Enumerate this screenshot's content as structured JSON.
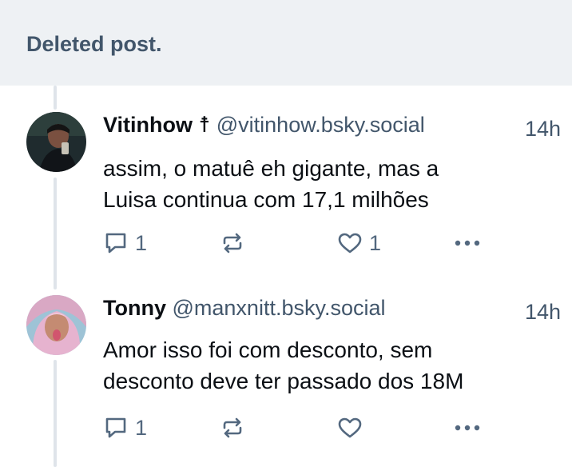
{
  "deleted_banner": {
    "text": "Deleted post."
  },
  "posts": [
    {
      "display_name": "Vitinhow",
      "name_suffix": "☨",
      "handle": "@vitinhow.bsky.social",
      "time": "14h",
      "text_line1": "assim, o matuê eh gigante, mas a",
      "text_line2": "Luisa continua com 17,1 milhões",
      "reply_count": "1",
      "repost_count": "",
      "like_count": "1",
      "liked": false
    },
    {
      "display_name": "Tonny",
      "handle": "@manxnitt.bsky.social",
      "time": "14h",
      "text_line1": "Amor isso foi com desconto, sem",
      "text_line2": "desconto deve ter passado dos 18M",
      "reply_count": "1",
      "repost_count": "",
      "like_count": "",
      "liked": false
    }
  ],
  "colors": {
    "banner_bg": "#eef1f4",
    "muted_text": "#42566b",
    "icon": "#53687f",
    "thread_line": "#dfe4ea"
  }
}
